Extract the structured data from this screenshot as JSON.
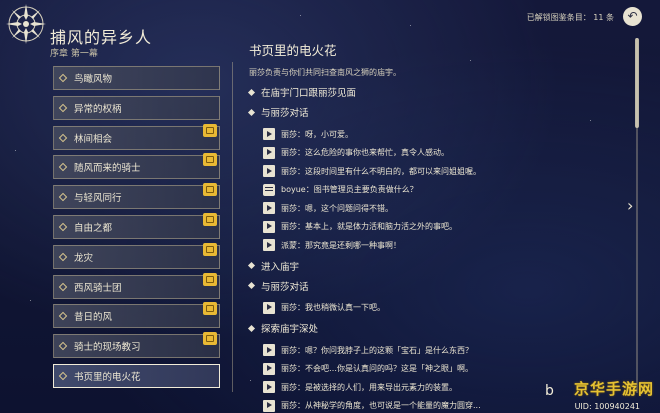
{
  "header": {
    "title": "捕风的异乡人",
    "subtitle": "序章 第一幕",
    "unlocked": "已解锁图鉴条目： 11 条",
    "back_icon": "back-arrow-icon"
  },
  "sidebar": {
    "chapters": [
      {
        "label": "鸟瞰风物",
        "new": false
      },
      {
        "label": "异常的权柄",
        "new": false
      },
      {
        "label": "林间相会",
        "new": true
      },
      {
        "label": "随风而来的骑士",
        "new": true
      },
      {
        "label": "与轻风同行",
        "new": true
      },
      {
        "label": "自由之都",
        "new": true
      },
      {
        "label": "龙灾",
        "new": true
      },
      {
        "label": "西风骑士团",
        "new": true
      },
      {
        "label": "昔日的风",
        "new": true
      },
      {
        "label": "骑士的现场教习",
        "new": true
      },
      {
        "label": "书页里的电火花",
        "new": false,
        "active": true
      }
    ]
  },
  "main": {
    "title": "书页里的电火花",
    "desc": "丽莎负责与你们共同扫查南风之狮的庙宇。",
    "sections": [
      {
        "title": "在庙宇门口跟丽莎见面",
        "lines": []
      },
      {
        "title": "与丽莎对话",
        "lines": [
          {
            "icon": "play",
            "text": "丽莎：呀，小可爱。"
          },
          {
            "icon": "play",
            "text": "丽莎：这么危险的事你也来帮忙，真令人感动。"
          },
          {
            "icon": "play",
            "text": "丽莎：这段时间里有什么不明白的，都可以来问姐姐喔。"
          },
          {
            "icon": "chat",
            "text": "boyue：图书管理员主要负责做什么？"
          },
          {
            "icon": "play",
            "text": "丽莎：嗯，这个问题问得不错。"
          },
          {
            "icon": "play",
            "text": "丽莎：基本上，就是体力活和脑力活之外的事吧。"
          },
          {
            "icon": "play",
            "text": "派蒙：那究竟是还剩哪一种事啊！"
          }
        ]
      },
      {
        "title": "进入庙宇",
        "lines": []
      },
      {
        "title": "与丽莎对话",
        "lines": [
          {
            "icon": "play",
            "text": "丽莎：我也稍微认真一下吧。"
          }
        ]
      },
      {
        "title": "探索庙宇深处",
        "lines": [
          {
            "icon": "play",
            "text": "丽莎：嗯？你问我脖子上的这颗「宝石」是什么东西？"
          },
          {
            "icon": "play",
            "text": "丽莎：不会吧…你是认真问的吗？这是「神之眼」啊。"
          },
          {
            "icon": "play",
            "text": "丽莎：是被选择的人们，用来导出元素力的装置。"
          },
          {
            "icon": "play",
            "text": "丽莎：从神秘学的角度，也可说是一个能量的魔力圆穿..."
          }
        ]
      }
    ]
  },
  "overlay": {
    "watermark": "京华手游网",
    "uid": "UID: 100940241",
    "stamp": "b"
  }
}
